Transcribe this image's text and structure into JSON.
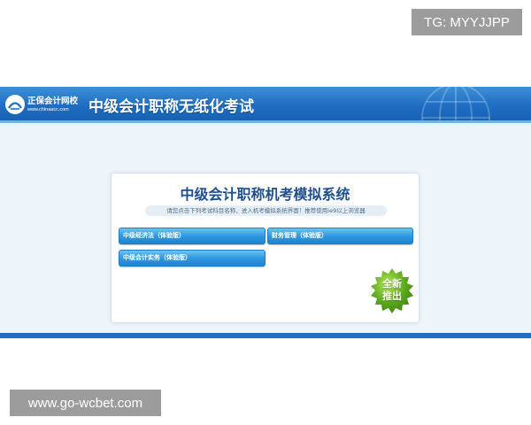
{
  "watermark": {
    "top_tag": "TG: MYYJJPP",
    "bottom_tag": "www.go-wcbet.com"
  },
  "header": {
    "logo_name": "正保会计网校",
    "logo_url": "www.chinaacc.com",
    "title": "中级会计职称无纸化考试"
  },
  "card": {
    "title": "中级会计职称机考模拟系统",
    "notice": "请您点击下列考试科目名称，进入机考模拟系统界面！推荐使用ie9以上浏览器",
    "subjects": [
      {
        "label": "中级经济法（体验版）"
      },
      {
        "label": "财务管理（体验版）"
      },
      {
        "label": "中级会计实务（体验版）"
      }
    ],
    "badge": {
      "line1": "全新",
      "line2": "推出"
    }
  },
  "colors": {
    "header_blue": "#1f6ec3",
    "title_blue": "#1e4f8f",
    "button_blue": "#2f98df",
    "badge_green": "#5aa81d"
  }
}
